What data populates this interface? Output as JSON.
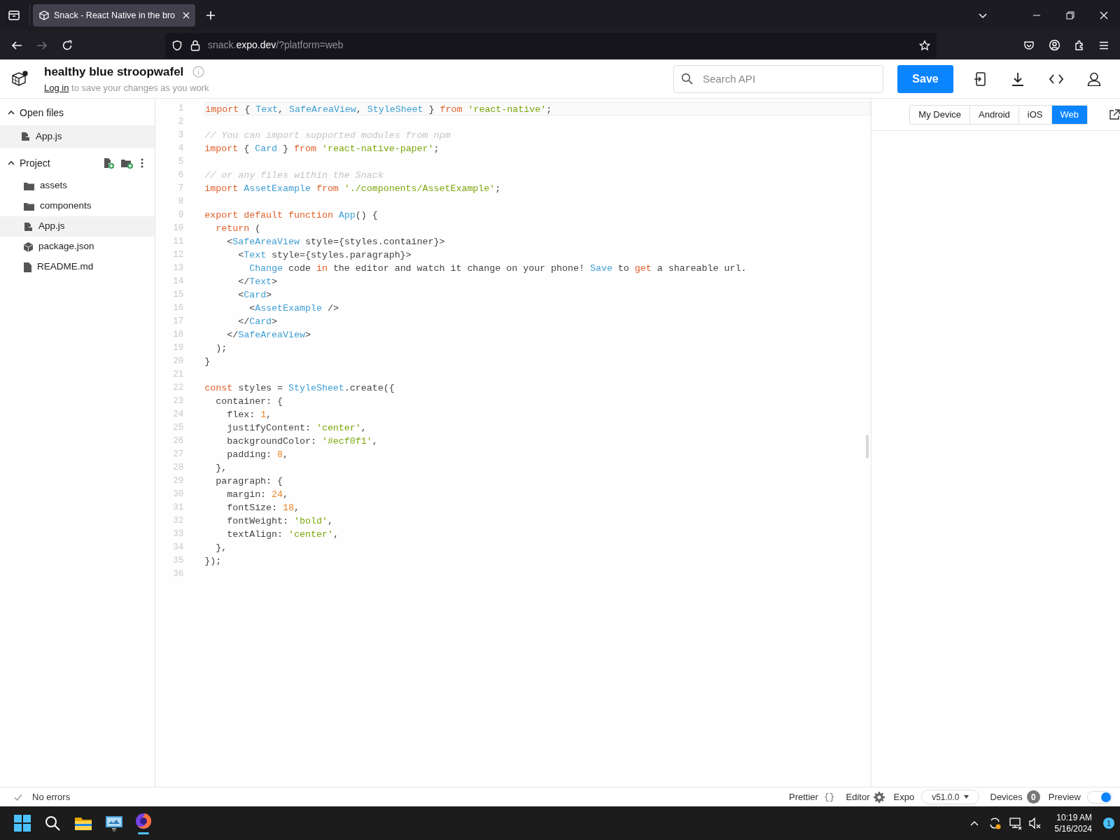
{
  "browser": {
    "tabs": [
      {
        "title": "Snack - React Native in the bro",
        "selected": true
      }
    ],
    "url_parts": [
      {
        "text": "snack.",
        "emphasized": false
      },
      {
        "text": "expo.dev",
        "emphasized": true
      },
      {
        "text": "/?platform=web",
        "emphasized": false
      }
    ]
  },
  "header": {
    "project_name": "healthy blue stroopwafel",
    "login_link": "Log in",
    "login_hint": "to save your changes as you work",
    "search": {
      "placeholder": "Search API"
    },
    "save_button": "Save"
  },
  "sidebar": {
    "sections": [
      {
        "title": "Open files",
        "expanded": true,
        "items": [
          {
            "name": "App.js",
            "kind": "file",
            "selected": true
          }
        ]
      },
      {
        "title": "Project",
        "expanded": true,
        "items": [
          {
            "name": "assets",
            "kind": "folder",
            "selected": false
          },
          {
            "name": "components",
            "kind": "folder",
            "selected": false
          },
          {
            "name": "App.js",
            "kind": "file",
            "selected": true
          },
          {
            "name": "package.json",
            "kind": "package",
            "selected": false
          },
          {
            "name": "README.md",
            "kind": "document",
            "selected": false
          }
        ]
      }
    ]
  },
  "editor": {
    "lines": [
      {
        "number": "1",
        "active": true,
        "tokens": [
          {
            "text": "import",
            "kind": "keyword"
          },
          {
            "text": " { ",
            "kind": "plain"
          },
          {
            "text": "Text",
            "kind": "type"
          },
          {
            "text": ", ",
            "kind": "plain"
          },
          {
            "text": "SafeAreaView",
            "kind": "type"
          },
          {
            "text": ", ",
            "kind": "plain"
          },
          {
            "text": "StyleSheet",
            "kind": "type"
          },
          {
            "text": " } ",
            "kind": "plain"
          },
          {
            "text": "from ",
            "kind": "keyword"
          },
          {
            "text": "'react-native'",
            "kind": "string"
          },
          {
            "text": ";",
            "kind": "plain"
          }
        ]
      },
      {
        "number": "2",
        "active": false
      },
      {
        "number": "3",
        "active": false,
        "tokens": [
          {
            "text": "// You can import supported modules from npm",
            "kind": "comment"
          }
        ]
      },
      {
        "number": "4",
        "active": false,
        "tokens": [
          {
            "text": "import",
            "kind": "keyword"
          },
          {
            "text": " { ",
            "kind": "plain"
          },
          {
            "text": "Card",
            "kind": "type"
          },
          {
            "text": " } ",
            "kind": "plain"
          },
          {
            "text": "from ",
            "kind": "keyword"
          },
          {
            "text": "'react-native-paper'",
            "kind": "string"
          },
          {
            "text": ";",
            "kind": "plain"
          }
        ]
      },
      {
        "number": "5",
        "active": false
      },
      {
        "number": "6",
        "active": false,
        "tokens": [
          {
            "text": "// or any files within the Snack",
            "kind": "comment"
          }
        ]
      },
      {
        "number": "7",
        "active": false,
        "tokens": [
          {
            "text": "import ",
            "kind": "keyword"
          },
          {
            "text": "AssetExample ",
            "kind": "type"
          },
          {
            "text": "from ",
            "kind": "keyword"
          },
          {
            "text": "'./components/AssetExample'",
            "kind": "string"
          },
          {
            "text": ";",
            "kind": "plain"
          }
        ]
      },
      {
        "number": "8",
        "active": false
      },
      {
        "number": "9",
        "active": false,
        "tokens": [
          {
            "text": "export default function ",
            "kind": "keyword"
          },
          {
            "text": "App",
            "kind": "type"
          },
          {
            "text": "() {",
            "kind": "plain"
          }
        ]
      },
      {
        "number": "10",
        "active": false,
        "tokens": [
          {
            "text": "  return",
            "kind": "keyword"
          },
          {
            "text": " (",
            "kind": "plain"
          }
        ]
      },
      {
        "number": "11",
        "active": false,
        "tokens": [
          {
            "text": "    <",
            "kind": "plain"
          },
          {
            "text": "SafeAreaView",
            "kind": "type"
          },
          {
            "text": " style={styles.container}>",
            "kind": "plain"
          }
        ]
      },
      {
        "number": "12",
        "active": false,
        "tokens": [
          {
            "text": "      <",
            "kind": "plain"
          },
          {
            "text": "Text",
            "kind": "type"
          },
          {
            "text": " style={styles.paragraph}>",
            "kind": "plain"
          }
        ]
      },
      {
        "number": "13",
        "active": false,
        "tokens": [
          {
            "text": "        Change",
            "kind": "type"
          },
          {
            "text": " code ",
            "kind": "plain"
          },
          {
            "text": "in",
            "kind": "keyword"
          },
          {
            "text": " the editor and watch it change on your phone! ",
            "kind": "plain"
          },
          {
            "text": "Save",
            "kind": "type"
          },
          {
            "text": " to ",
            "kind": "plain"
          },
          {
            "text": "get",
            "kind": "keyword"
          },
          {
            "text": " a shareable url.",
            "kind": "plain"
          }
        ]
      },
      {
        "number": "14",
        "active": false,
        "tokens": [
          {
            "text": "      </",
            "kind": "plain"
          },
          {
            "text": "Text",
            "kind": "type"
          },
          {
            "text": ">",
            "kind": "plain"
          }
        ]
      },
      {
        "number": "15",
        "active": false,
        "tokens": [
          {
            "text": "      <",
            "kind": "plain"
          },
          {
            "text": "Card",
            "kind": "type"
          },
          {
            "text": ">",
            "kind": "plain"
          }
        ]
      },
      {
        "number": "16",
        "active": false,
        "tokens": [
          {
            "text": "        <",
            "kind": "plain"
          },
          {
            "text": "AssetExample",
            "kind": "type"
          },
          {
            "text": " />",
            "kind": "plain"
          }
        ]
      },
      {
        "number": "17",
        "active": false,
        "tokens": [
          {
            "text": "      </",
            "kind": "plain"
          },
          {
            "text": "Card",
            "kind": "type"
          },
          {
            "text": ">",
            "kind": "plain"
          }
        ]
      },
      {
        "number": "18",
        "active": false,
        "tokens": [
          {
            "text": "    </",
            "kind": "plain"
          },
          {
            "text": "SafeAreaView",
            "kind": "type"
          },
          {
            "text": ">",
            "kind": "plain"
          }
        ]
      },
      {
        "number": "19",
        "active": false,
        "tokens": [
          {
            "text": "  );",
            "kind": "plain"
          }
        ]
      },
      {
        "number": "20",
        "active": false,
        "tokens": [
          {
            "text": "}",
            "kind": "plain"
          }
        ]
      },
      {
        "number": "21",
        "active": false
      },
      {
        "number": "22",
        "active": false,
        "tokens": [
          {
            "text": "const",
            "kind": "keyword"
          },
          {
            "text": " styles = ",
            "kind": "plain"
          },
          {
            "text": "StyleSheet",
            "kind": "type"
          },
          {
            "text": ".create({",
            "kind": "plain"
          }
        ]
      },
      {
        "number": "23",
        "active": false,
        "tokens": [
          {
            "text": "  container: {",
            "kind": "plain"
          }
        ]
      },
      {
        "number": "24",
        "active": false,
        "tokens": [
          {
            "text": "    flex: ",
            "kind": "plain"
          },
          {
            "text": "1",
            "kind": "number"
          },
          {
            "text": ",",
            "kind": "plain"
          }
        ]
      },
      {
        "number": "25",
        "active": false,
        "tokens": [
          {
            "text": "    justifyContent: ",
            "kind": "plain"
          },
          {
            "text": "'center'",
            "kind": "string"
          },
          {
            "text": ",",
            "kind": "plain"
          }
        ]
      },
      {
        "number": "26",
        "active": false,
        "tokens": [
          {
            "text": "    backgroundColor: ",
            "kind": "plain"
          },
          {
            "text": "'#ecf0f1'",
            "kind": "string"
          },
          {
            "text": ",",
            "kind": "plain"
          }
        ]
      },
      {
        "number": "27",
        "active": false,
        "tokens": [
          {
            "text": "    padding: ",
            "kind": "plain"
          },
          {
            "text": "8",
            "kind": "number"
          },
          {
            "text": ",",
            "kind": "plain"
          }
        ]
      },
      {
        "number": "28",
        "active": false,
        "tokens": [
          {
            "text": "  },",
            "kind": "plain"
          }
        ]
      },
      {
        "number": "29",
        "active": false,
        "tokens": [
          {
            "text": "  paragraph: {",
            "kind": "plain"
          }
        ]
      },
      {
        "number": "30",
        "active": false,
        "tokens": [
          {
            "text": "    margin: ",
            "kind": "plain"
          },
          {
            "text": "24",
            "kind": "number"
          },
          {
            "text": ",",
            "kind": "plain"
          }
        ]
      },
      {
        "number": "31",
        "active": false,
        "tokens": [
          {
            "text": "    fontSize: ",
            "kind": "plain"
          },
          {
            "text": "18",
            "kind": "number"
          },
          {
            "text": ",",
            "kind": "plain"
          }
        ]
      },
      {
        "number": "32",
        "active": false,
        "tokens": [
          {
            "text": "    fontWeight: ",
            "kind": "plain"
          },
          {
            "text": "'bold'",
            "kind": "string"
          },
          {
            "text": ",",
            "kind": "plain"
          }
        ]
      },
      {
        "number": "33",
        "active": false,
        "tokens": [
          {
            "text": "    textAlign: ",
            "kind": "plain"
          },
          {
            "text": "'center'",
            "kind": "string"
          },
          {
            "text": ",",
            "kind": "plain"
          }
        ]
      },
      {
        "number": "34",
        "active": false,
        "tokens": [
          {
            "text": "  },",
            "kind": "plain"
          }
        ]
      },
      {
        "number": "35",
        "active": false,
        "tokens": [
          {
            "text": "});",
            "kind": "plain"
          }
        ]
      },
      {
        "number": "36",
        "active": false
      }
    ]
  },
  "preview": {
    "platforms": [
      {
        "label": "My Device",
        "selected": false
      },
      {
        "label": "Android",
        "selected": false
      },
      {
        "label": "iOS",
        "selected": false
      },
      {
        "label": "Web",
        "selected": true
      }
    ]
  },
  "status_bar": {
    "message": "No errors",
    "prettier": "Prettier",
    "prettier_glyph": "{}",
    "editor": "Editor",
    "sdk_label": "Expo",
    "sdk_version": "v51.0.0",
    "devices_label": "Devices",
    "devices_count": "0",
    "preview_label": "Preview",
    "preview_on": true
  },
  "taskbar": {
    "time": "10:19 AM",
    "date": "5/16/2024",
    "notification_count": "1"
  }
}
